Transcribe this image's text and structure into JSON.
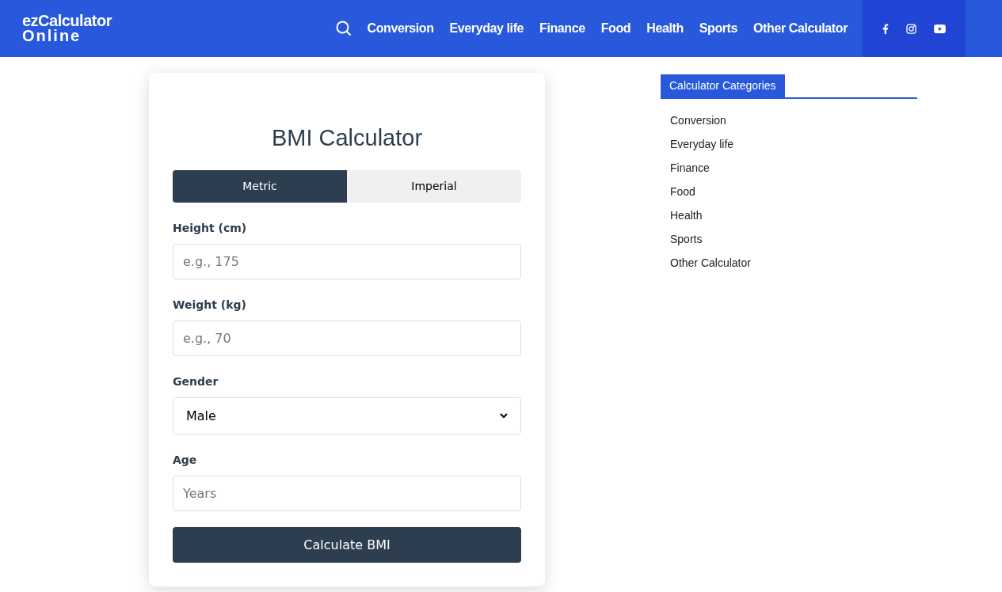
{
  "header": {
    "logo_lines": [
      "ezCalculator",
      "Online"
    ],
    "nav": [
      "Conversion",
      "Everyday life",
      "Finance",
      "Food",
      "Health",
      "Sports",
      "Other Calculator"
    ],
    "social": [
      {
        "kind": "facebook"
      },
      {
        "kind": "instagram"
      },
      {
        "kind": "youtube"
      }
    ]
  },
  "calculator": {
    "title": "BMI Calculator",
    "tabs": [
      {
        "label": "Metric",
        "selected": true
      },
      {
        "label": "Imperial",
        "selected": false
      }
    ],
    "fields": [
      {
        "kind": "input",
        "label": "Height (cm)",
        "placeholder": "e.g., 175"
      },
      {
        "kind": "input",
        "label": "Weight (kg)",
        "placeholder": "e.g., 70"
      },
      {
        "kind": "select",
        "label": "Gender",
        "value": "Male"
      },
      {
        "kind": "input",
        "label": "Age",
        "placeholder": "Years"
      }
    ],
    "button": "Calculate BMI"
  },
  "sidebar": {
    "heading": "Calculator Categories",
    "items": [
      "Conversion",
      "Everyday life",
      "Finance",
      "Food",
      "Health",
      "Sports",
      "Other Calculator"
    ]
  }
}
